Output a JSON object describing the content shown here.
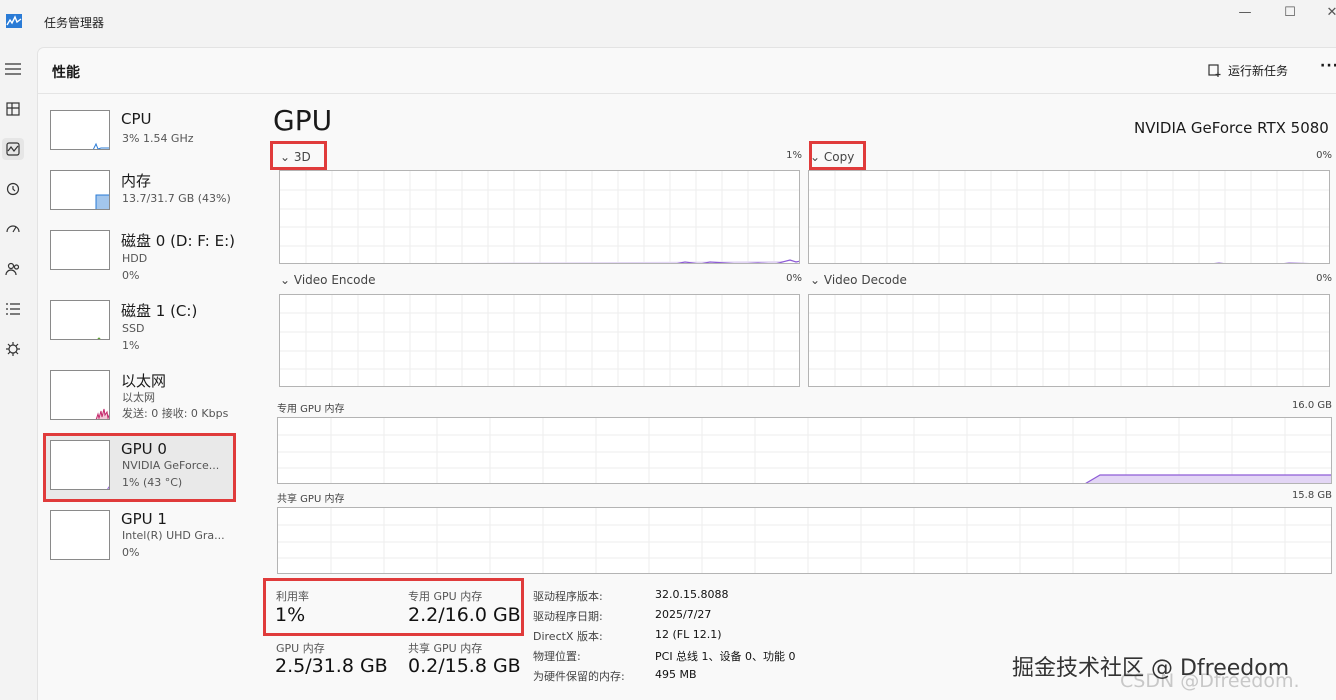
{
  "window": {
    "title": "任务管理器",
    "minimize_glyph": "—",
    "maximize_glyph": "☐",
    "close_glyph": "✕"
  },
  "rail": {
    "items": [
      {
        "name": "hamburger-icon"
      },
      {
        "name": "processes-icon"
      },
      {
        "name": "performance-icon"
      },
      {
        "name": "app-history-icon"
      },
      {
        "name": "startup-apps-icon"
      },
      {
        "name": "users-icon"
      },
      {
        "name": "details-icon"
      },
      {
        "name": "services-icon"
      }
    ]
  },
  "header": {
    "title": "性能",
    "run_new_task": "运行新任务",
    "more": "···"
  },
  "devices": [
    {
      "name": "CPU",
      "sub1": "3%  1.54 GHz",
      "sub2": ""
    },
    {
      "name": "内存",
      "sub1": "13.7/31.7 GB (43%)",
      "sub2": ""
    },
    {
      "name": "磁盘 0 (D: F: E:)",
      "sub1": "HDD",
      "sub2": "0%"
    },
    {
      "name": "磁盘 1 (C:)",
      "sub1": "SSD",
      "sub2": "1%"
    },
    {
      "name": "以太网",
      "sub1": "以太网",
      "sub2": "发送: 0  接收: 0 Kbps"
    },
    {
      "name": "GPU 0",
      "sub1": "NVIDIA GeForce...",
      "sub2": "1% (43 °C)"
    },
    {
      "name": "GPU 1",
      "sub1": "Intel(R) UHD Gra...",
      "sub2": "0%"
    }
  ],
  "gpu": {
    "title": "GPU",
    "model": "NVIDIA GeForce RTX 5080",
    "engines": [
      {
        "label": "3D",
        "pct": "1%"
      },
      {
        "label": "Copy",
        "pct": "0%"
      },
      {
        "label": "Video Encode",
        "pct": "0%"
      },
      {
        "label": "Video Decode",
        "pct": "0%"
      }
    ],
    "dedicated_label": "专用 GPU 内存",
    "dedicated_max": "16.0 GB",
    "shared_label": "共享 GPU 内存",
    "shared_max": "15.8 GB",
    "chevron": "⌄"
  },
  "stats": {
    "util_label": "利用率",
    "util_value": "1%",
    "dedicated_label": "专用 GPU 内存",
    "dedicated_value": "2.2/16.0 GB",
    "gpu_mem_label": "GPU 内存",
    "gpu_mem_value": "2.5/31.8 GB",
    "shared_label": "共享 GPU 内存",
    "shared_value": "0.2/15.8 GB"
  },
  "info": [
    {
      "label": "驱动程序版本:",
      "value": "32.0.15.8088"
    },
    {
      "label": "驱动程序日期:",
      "value": "2025/7/27"
    },
    {
      "label": "DirectX 版本:",
      "value": "12 (FL 12.1)"
    },
    {
      "label": "物理位置:",
      "value": "PCI 总线 1、设备 0、功能 0"
    },
    {
      "label": "为硬件保留的内存:",
      "value": "495 MB"
    }
  ],
  "watermark": "掘金技术社区 @ Dfreedom",
  "watermark2": "CSDN @Dfreedom.",
  "colors": {
    "gpu_line": "#8e5cd6",
    "gpu_fill": "#e3d6f5",
    "mem_fill": "#a3c6ec",
    "highlight": "#e03b3b"
  }
}
